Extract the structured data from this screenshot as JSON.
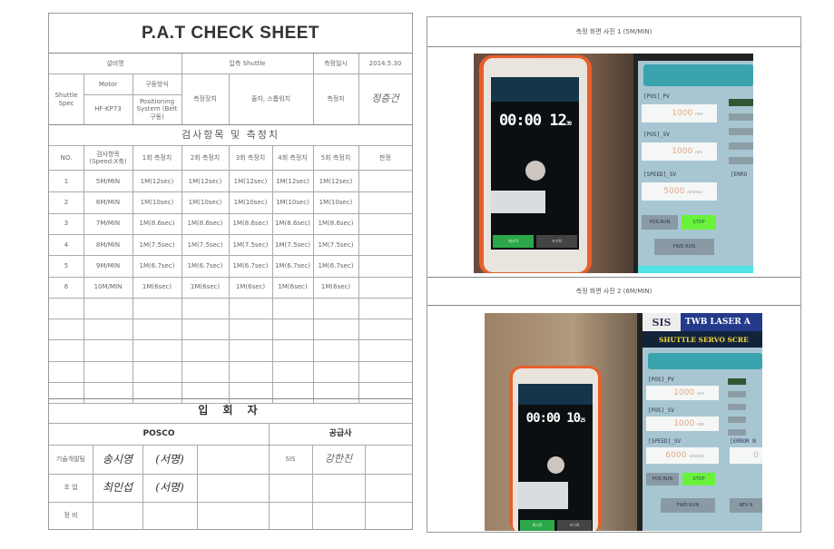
{
  "sheet": {
    "title": "P.A.T CHECK SHEET",
    "header": {
      "equipment_name_label": "설비명",
      "equipment_name_value": "입측 Shuttle",
      "date_label": "측정일시",
      "date_value": "2014.5.30",
      "spec_label": "Shuttle Spec",
      "motor_label": "Motor",
      "motor_value": "HF-KP73",
      "drive_label": "구동방식",
      "drive_value": "Positioning System (Belt 구동)",
      "device_label": "측정장치",
      "device_value": "줄자, 스톱워치",
      "measurer_label": "측정자",
      "measurer_signature": "정층건"
    },
    "section_title": "검사항목 및 측정치",
    "columns": [
      "NO.",
      "검사항목 (Speed:X축)",
      "1회 측정치",
      "2회 측정치",
      "3회 측정치",
      "4회 측정치",
      "5회 측정치",
      "판정"
    ],
    "rows": [
      {
        "no": "1",
        "item": "5M/MIN",
        "m1": "1M(12sec)",
        "m2": "1M(12sec)",
        "m3": "1M(12sec)",
        "m4": "1M(12sec)",
        "m5": "1M(12sec)",
        "result": ""
      },
      {
        "no": "2",
        "item": "6M/MIN",
        "m1": "1M(10sec)",
        "m2": "1M(10sec)",
        "m3": "1M(10sec)",
        "m4": "1M(10sec)",
        "m5": "1M(10sec)",
        "result": ""
      },
      {
        "no": "3",
        "item": "7M/MIN",
        "m1": "1M(8.6sec)",
        "m2": "1M(8.6sec)",
        "m3": "1M(8.6sec)",
        "m4": "1M(8.6sec)",
        "m5": "1M(8.6sec)",
        "result": ""
      },
      {
        "no": "4",
        "item": "8M/MIN",
        "m1": "1M(7.5sec)",
        "m2": "1M(7.5sec)",
        "m3": "1M(7.5sec)",
        "m4": "1M(7.5sec)",
        "m5": "1M(7.5sec)",
        "result": ""
      },
      {
        "no": "5",
        "item": "9M/MIN",
        "m1": "1M(6.7sec)",
        "m2": "1M(6.7sec)",
        "m3": "1M(6.7sec)",
        "m4": "1M(6.7sec)",
        "m5": "1M(6.7sec)",
        "result": ""
      },
      {
        "no": "6",
        "item": "10M/MIN",
        "m1": "1M(6sec)",
        "m2": "1M(6sec)",
        "m3": "1M(6sec)",
        "m4": "1M(6sec)",
        "m5": "1M(6sec)",
        "result": ""
      }
    ],
    "attendees": {
      "title": "입 회 자",
      "posco_label": "POSCO",
      "supplier_label": "공급사",
      "rows": [
        {
          "dept": "기술개발팀",
          "sig1": "송시영",
          "sig2": "(서명)",
          "supplier": "SIS",
          "supplier_sig": "강한진"
        },
        {
          "dept": "조  업",
          "sig1": "최인섭",
          "sig2": "(서명)",
          "supplier": "",
          "supplier_sig": ""
        },
        {
          "dept": "정  비",
          "sig1": "",
          "sig2": "",
          "supplier": "",
          "supplier_sig": ""
        }
      ]
    }
  },
  "photos": [
    {
      "caption": "측정 화면 사진 1 (5M/MIN)",
      "stopwatch": {
        "main": "00:00 12",
        "sub": "39",
        "left_button": "재시작",
        "right_button": "초기화"
      },
      "hmi": {
        "pos_pv_label": "[POS]_PV",
        "pos_pv": "1000",
        "pos_pv_unit": "mm",
        "pos_sv_label": "[POS]_SV",
        "pos_sv": "1000",
        "pos_sv_unit": "mm",
        "speed_sv_label": "[SPEED]_SV",
        "speed_sv": "5000",
        "speed_sv_unit": "mm/min",
        "error_label": "[ERRO",
        "btn_pos_run": "POS.RUN",
        "btn_stop": "STOP",
        "btn_fwd_run": "FWD RUN"
      }
    },
    {
      "caption": "측정 화면 사진 2 (6M/MIN)",
      "stopwatch": {
        "main": "00:00 10",
        "sub": "25",
        "left_button": "재시작",
        "right_button": "초기화"
      },
      "hmi": {
        "logo": "SIS",
        "banner": "TWB LASER A",
        "subtitle": "SHUTTLE SERVO SCRE",
        "pos_pv_label": "[POS]_PV",
        "pos_pv": "1000",
        "pos_pv_unit": "mm",
        "pos_sv_label": "[POS]_SV",
        "pos_sv": "1000",
        "pos_sv_unit": "mm",
        "speed_sv_label": "[SPEED]_SV",
        "speed_sv": "6000",
        "speed_sv_unit": "mm/min",
        "error_label": "[ERROR N",
        "error_value": "0",
        "btn_pos_run": "POS.RUN",
        "btn_stop": "STOP",
        "btn_fwd_run": "FWD RUN",
        "btn_rev_run": "REV R"
      }
    }
  ]
}
